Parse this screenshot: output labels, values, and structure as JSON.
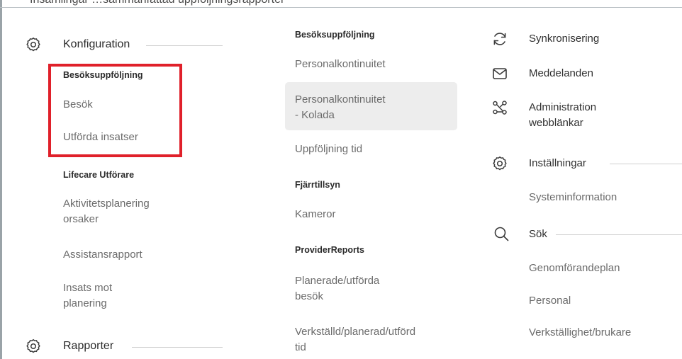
{
  "top_text": "Insamlingar       …sammanfattad uppföljningsrapporter",
  "left": {
    "konfiguration": "Konfiguration",
    "besoksuppfoljning_head": "Besöksuppföljning",
    "besok": "Besök",
    "utforda_insatser": "Utförda insatser",
    "lifecare_head": "Lifecare Utförare",
    "aktivitetsplanering_1": "Aktivitetsplanering",
    "aktivitetsplanering_2": "orsaker",
    "assistansrapport": "Assistansrapport",
    "insats_mot_1": "Insats mot",
    "insats_mot_2": "planering",
    "rapporter": "Rapporter"
  },
  "middle": {
    "besoksuppfoljning_head": "Besöksuppföljning",
    "personalkontinuitet": "Personalkontinuitet",
    "personalkontinuitet_kolada_1": "Personalkontinuitet",
    "personalkontinuitet_kolada_2": "- Kolada",
    "uppfoljning_tid": "Uppföljning tid",
    "fjarrtillsyn_head": "Fjärrtillsyn",
    "kameror": "Kameror",
    "providerreports_head": "ProviderReports",
    "planerade_1": "Planerade/utförda",
    "planerade_2": "besök",
    "verkstalld_1": "Verkställd/planerad/utförd",
    "verkstalld_2": "tid"
  },
  "right": {
    "synkronisering": "Synkronisering",
    "meddelanden": "Meddelanden",
    "administration_1": "Administration",
    "administration_2": "webblänkar",
    "installningar": "Inställningar",
    "systeminformation": "Systeminformation",
    "sok": "Sök",
    "genomforandeplan": "Genomförandeplan",
    "personal": "Personal",
    "verkstallighet": "Verkställighet/brukare"
  },
  "colors": {
    "highlight_box": "#e0202a",
    "hover_bg": "#ededed"
  }
}
